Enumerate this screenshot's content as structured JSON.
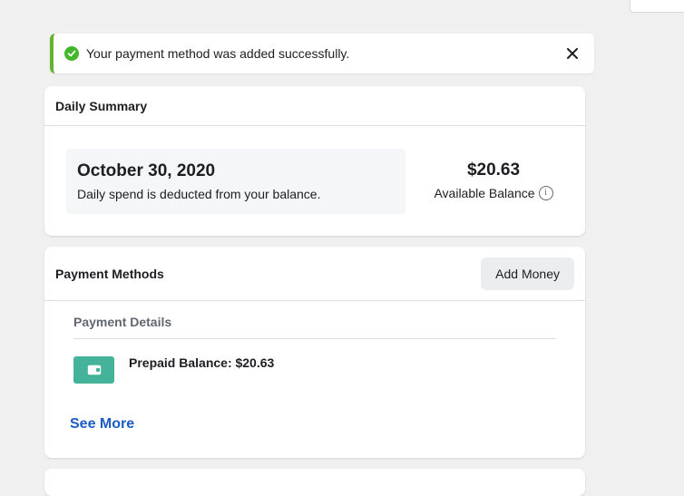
{
  "toast": {
    "message": "Your payment method was added successfully.",
    "icon": "check-circle-icon",
    "accent_color": "#63b32e"
  },
  "daily_summary": {
    "title": "Daily Summary",
    "date": "October 30, 2020",
    "note": "Daily spend is deducted from your balance.",
    "balance_amount": "$20.63",
    "balance_label": "Available Balance",
    "info_icon": "info-icon"
  },
  "payment_methods": {
    "title": "Payment Methods",
    "add_money_label": "Add Money",
    "details_label": "Payment Details",
    "items": [
      {
        "icon": "wallet-icon",
        "label": "Prepaid Balance: $20.63",
        "icon_color": "#44b39a"
      }
    ],
    "see_more_label": "See More",
    "link_color": "#1b5bc4"
  }
}
